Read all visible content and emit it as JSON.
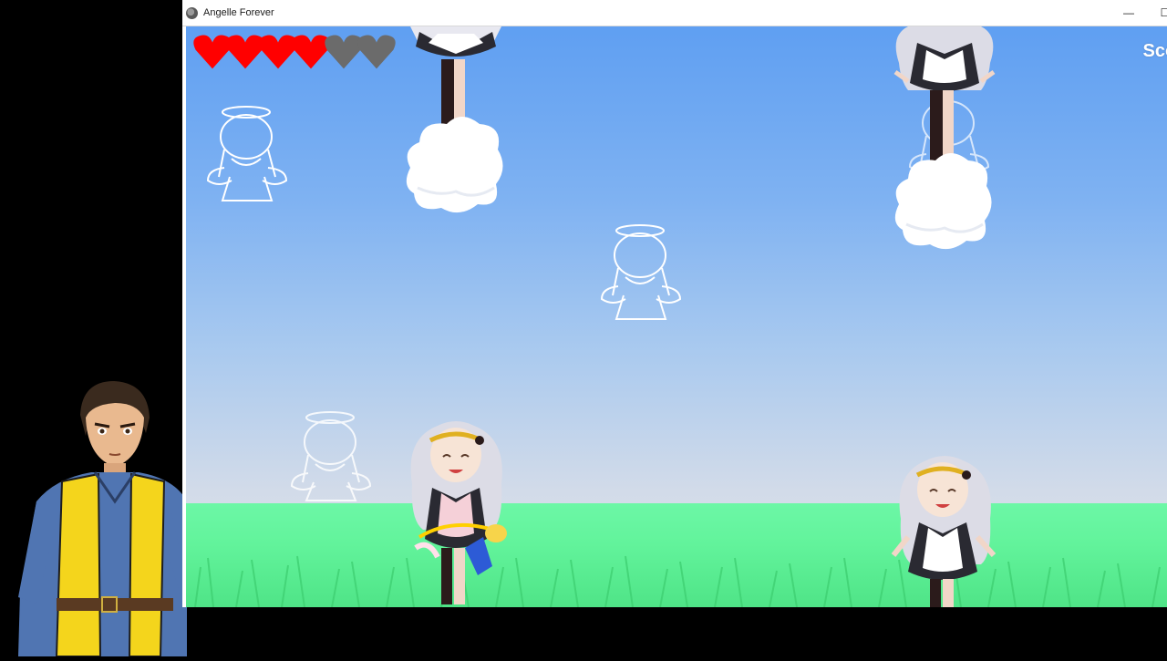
{
  "window": {
    "title": "Angelle Forever",
    "minimize_glyph": "—",
    "maximize_glyph": "☐"
  },
  "hud": {
    "hearts_total": 6,
    "hearts_filled": 4,
    "heart_full_color": "#ff0000",
    "heart_empty_color": "#6b6b6b",
    "score_label": "Scor"
  },
  "colors": {
    "sky_top": "#5f9ff2",
    "grass": "#62f39b",
    "outline_ghost": "#ffffff"
  },
  "icons": [
    "app-icon",
    "heart-icon",
    "ghost-angel-icon",
    "maid-angel-sprite",
    "cloud-sprite",
    "player-sprite",
    "streamer-avatar"
  ]
}
